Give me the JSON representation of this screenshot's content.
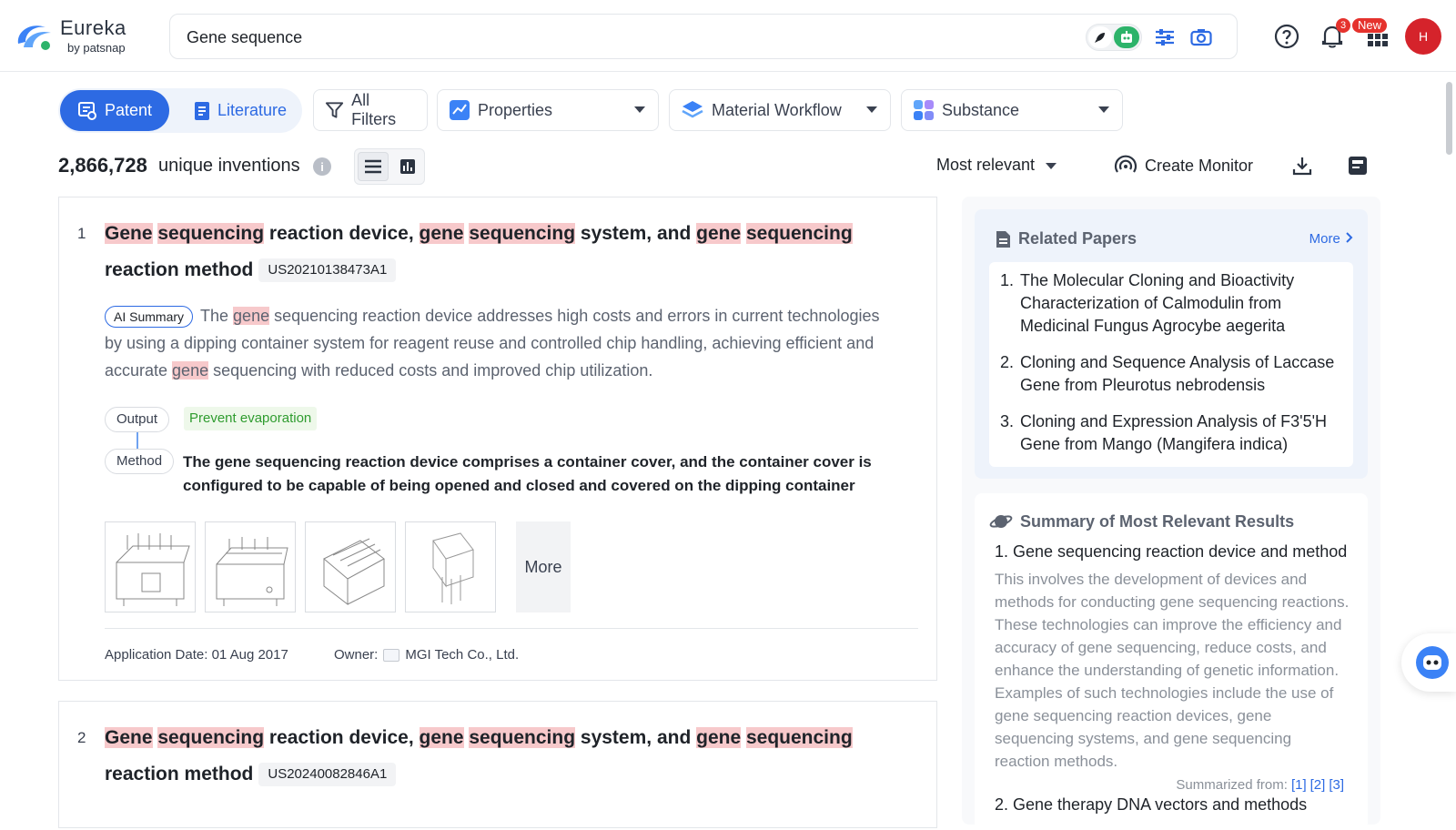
{
  "brand": {
    "name": "Eureka",
    "byline": "by patsnap"
  },
  "search": {
    "value": "Gene sequence",
    "placeholder": ""
  },
  "header": {
    "notifications_count": "3",
    "apps_badge": "New",
    "avatar_initial": "H"
  },
  "tabs": {
    "patent": "Patent",
    "literature": "Literature"
  },
  "filters": {
    "all_filters": "All Filters",
    "properties": "Properties",
    "material_workflow": "Material Workflow",
    "substance": "Substance"
  },
  "results": {
    "count": "2,866,728",
    "count_label": "unique inventions",
    "sort": "Most relevant",
    "create_monitor": "Create Monitor"
  },
  "result1": {
    "rank": "1",
    "title": [
      {
        "t": "Gene",
        "h": true
      },
      {
        "t": " ",
        "h": false
      },
      {
        "t": "sequencing",
        "h": true
      },
      {
        "t": " reaction device, ",
        "h": false
      },
      {
        "t": "gene",
        "h": true
      },
      {
        "t": " ",
        "h": false
      },
      {
        "t": "sequencing",
        "h": true
      },
      {
        "t": " system, and ",
        "h": false
      },
      {
        "t": "gene",
        "h": true
      },
      {
        "t": " ",
        "h": false
      },
      {
        "t": "sequencing",
        "h": true
      },
      {
        "t": " reaction method",
        "h": false
      }
    ],
    "pub_no": "US20210138473A1",
    "ai_summary_label": "AI Summary",
    "summary": [
      {
        "t": "The ",
        "h": false
      },
      {
        "t": "gene",
        "h": true
      },
      {
        "t": " sequencing reaction device addresses high costs and errors in current technologies by using a dipping container system for reagent reuse and controlled chip handling, achieving efficient and accurate ",
        "h": false
      },
      {
        "t": "gene",
        "h": true
      },
      {
        "t": " sequencing with reduced costs and improved chip utilization.",
        "h": false
      }
    ],
    "output_label": "Output",
    "output_value": "Prevent evaporation",
    "method_label": "Method",
    "method_value": "The gene sequencing reaction device comprises a container cover, and the container cover is configured to be capable of being opened and closed and covered on the dipping container",
    "thumbs_more": "More",
    "app_date_label": "Application Date:",
    "app_date": "01 Aug 2017",
    "owner_label": "Owner:",
    "owner": "MGI Tech Co., Ltd."
  },
  "result2": {
    "rank": "2",
    "title": [
      {
        "t": "Gene",
        "h": true
      },
      {
        "t": " ",
        "h": false
      },
      {
        "t": "sequencing",
        "h": true
      },
      {
        "t": " reaction device, ",
        "h": false
      },
      {
        "t": "gene",
        "h": true
      },
      {
        "t": " ",
        "h": false
      },
      {
        "t": "sequencing",
        "h": true
      },
      {
        "t": " system, and ",
        "h": false
      },
      {
        "t": "gene",
        "h": true
      },
      {
        "t": " ",
        "h": false
      },
      {
        "t": "sequencing",
        "h": true
      },
      {
        "t": " reaction method",
        "h": false
      }
    ],
    "pub_no": "US20240082846A1"
  },
  "related_papers": {
    "title": "Related Papers",
    "more": "More",
    "items": [
      {
        "n": "1.",
        "text": "The Molecular Cloning and Bioactivity Characterization of Calmodulin from Medicinal Fungus Agrocybe aegerita"
      },
      {
        "n": "2.",
        "text": "Cloning and Sequence Analysis of Laccase Gene from Pleurotus nebrodensis"
      },
      {
        "n": "3.",
        "text": "Cloning and Expression Analysis of F3'5'H Gene from Mango (Mangifera indica)"
      }
    ]
  },
  "summary_panel": {
    "title": "Summary of Most Relevant Results",
    "item1": "1. Gene sequencing reaction device and method",
    "item1_body": "This involves the development of devices and methods for conducting gene sequencing reactions. These technologies can improve the efficiency and accuracy of gene sequencing, reduce costs, and enhance the understanding of genetic information. Examples of such technologies include the use of gene sequencing reaction devices, gene sequencing systems, and gene sequencing reaction methods.",
    "summarized_from": "Summarized from:",
    "refs": [
      "[1]",
      "[2]",
      "[3]"
    ],
    "item2": "2. Gene therapy DNA vectors and methods"
  },
  "colors": {
    "accent": "#2d6ae3",
    "highlight": "#f7c9cb",
    "green": "#2db36a",
    "badge_red": "#e5322d"
  }
}
